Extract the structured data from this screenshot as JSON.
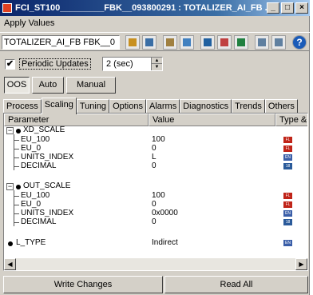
{
  "window": {
    "title": "FCI_ST100_________FBK__093800291 : TOTALIZER_AI_FB ..."
  },
  "titlebar_buttons": {
    "minimize": "_",
    "maximize": "□",
    "close": "×"
  },
  "menu": {
    "apply_values": "Apply Values"
  },
  "toolbar": {
    "block_select_value": "TOTALIZER_AI_FB  FBK__0",
    "icons": [
      "chart-icon",
      "chart-icon",
      "print-icon",
      "compare-icon",
      "save-icon",
      "load-icon",
      "settings-icon",
      "view-icon",
      "grid-icon",
      "help-icon"
    ],
    "help_label": "?"
  },
  "periodic": {
    "label": "Periodic Updates",
    "checked_mark": "✔",
    "interval": "2 (sec)"
  },
  "modes": {
    "oos": "OOS",
    "auto": "Auto",
    "manual": "Manual",
    "active": "OOS"
  },
  "tabs": [
    "Process",
    "Scaling",
    "Tuning",
    "Options",
    "Alarms",
    "Diagnostics",
    "Trends",
    "Others"
  ],
  "active_tab": "Scaling",
  "grid": {
    "headers": {
      "parameter": "Parameter",
      "value": "Value",
      "type": "Type & E:"
    },
    "groups": [
      {
        "name": "XD_SCALE",
        "expander": "−",
        "items": [
          {
            "name": "EU_100",
            "value": "100",
            "type": "float"
          },
          {
            "name": "EU_0",
            "value": "0",
            "type": "float"
          },
          {
            "name": "UNITS_INDEX",
            "value": "L",
            "type": "enum"
          },
          {
            "name": "DECIMAL",
            "value": "0",
            "type": "int"
          }
        ]
      },
      {
        "name": "OUT_SCALE",
        "expander": "−",
        "items": [
          {
            "name": "EU_100",
            "value": "100",
            "type": "float"
          },
          {
            "name": "EU_0",
            "value": "0",
            "type": "float"
          },
          {
            "name": "UNITS_INDEX",
            "value": "0x0000",
            "type": "enum"
          },
          {
            "name": "DECIMAL",
            "value": "0",
            "type": "int"
          }
        ]
      }
    ],
    "single": {
      "name": "L_TYPE",
      "value": "Indirect",
      "type": "enum"
    }
  },
  "scrollbar": {
    "left_arrow": "◀",
    "right_arrow": "▶"
  },
  "footer": {
    "write_changes": "Write Changes",
    "read_all": "Read All"
  },
  "colors": {
    "float": "#c02418",
    "enum": "#3a5ea8",
    "int": "#2a5a9a"
  }
}
